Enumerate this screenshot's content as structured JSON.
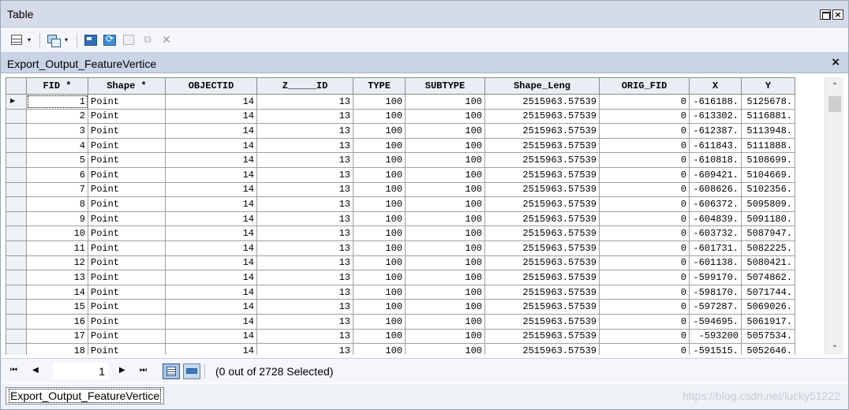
{
  "window": {
    "title": "Table"
  },
  "toolbar": {
    "icons": [
      "table-options-icon",
      "related-tables-icon",
      "select-by-attributes-icon",
      "switch-selection-icon",
      "clear-selection-icon",
      "zoom-to-selected-icon",
      "delete-selected-icon"
    ]
  },
  "tab": {
    "title": "Export_Output_FeatureVertice",
    "close": "×"
  },
  "table": {
    "columns": [
      "FID *",
      "Shape *",
      "OBJECTID",
      "Z_____ID",
      "TYPE",
      "SUBTYPE",
      "Shape_Leng",
      "ORIG_FID",
      "X",
      "Y"
    ],
    "rows": [
      [
        "1",
        "Point",
        "14",
        "13",
        "100",
        "100",
        "2515963.57539",
        "0",
        "-616188.",
        "5125678."
      ],
      [
        "2",
        "Point",
        "14",
        "13",
        "100",
        "100",
        "2515963.57539",
        "0",
        "-613302.",
        "5116881."
      ],
      [
        "3",
        "Point",
        "14",
        "13",
        "100",
        "100",
        "2515963.57539",
        "0",
        "-612387.",
        "5113948."
      ],
      [
        "4",
        "Point",
        "14",
        "13",
        "100",
        "100",
        "2515963.57539",
        "0",
        "-611843.",
        "5111888."
      ],
      [
        "5",
        "Point",
        "14",
        "13",
        "100",
        "100",
        "2515963.57539",
        "0",
        "-610818.",
        "5108699."
      ],
      [
        "6",
        "Point",
        "14",
        "13",
        "100",
        "100",
        "2515963.57539",
        "0",
        "-609421.",
        "5104669."
      ],
      [
        "7",
        "Point",
        "14",
        "13",
        "100",
        "100",
        "2515963.57539",
        "0",
        "-608626.",
        "5102356."
      ],
      [
        "8",
        "Point",
        "14",
        "13",
        "100",
        "100",
        "2515963.57539",
        "0",
        "-606372.",
        "5095809."
      ],
      [
        "9",
        "Point",
        "14",
        "13",
        "100",
        "100",
        "2515963.57539",
        "0",
        "-604839.",
        "5091180."
      ],
      [
        "10",
        "Point",
        "14",
        "13",
        "100",
        "100",
        "2515963.57539",
        "0",
        "-603732.",
        "5087947."
      ],
      [
        "11",
        "Point",
        "14",
        "13",
        "100",
        "100",
        "2515963.57539",
        "0",
        "-601731.",
        "5082225."
      ],
      [
        "12",
        "Point",
        "14",
        "13",
        "100",
        "100",
        "2515963.57539",
        "0",
        "-601138.",
        "5080421."
      ],
      [
        "13",
        "Point",
        "14",
        "13",
        "100",
        "100",
        "2515963.57539",
        "0",
        "-599170.",
        "5074862."
      ],
      [
        "14",
        "Point",
        "14",
        "13",
        "100",
        "100",
        "2515963.57539",
        "0",
        "-598170.",
        "5071744."
      ],
      [
        "15",
        "Point",
        "14",
        "13",
        "100",
        "100",
        "2515963.57539",
        "0",
        "-597287.",
        "5069026."
      ],
      [
        "16",
        "Point",
        "14",
        "13",
        "100",
        "100",
        "2515963.57539",
        "0",
        "-594695.",
        "5061917."
      ],
      [
        "17",
        "Point",
        "14",
        "13",
        "100",
        "100",
        "2515963.57539",
        "0",
        "-593200",
        "5057534."
      ],
      [
        "18",
        "Point",
        "14",
        "13",
        "100",
        "100",
        "2515963.57539",
        "0",
        "-591515.",
        "5052646."
      ]
    ]
  },
  "navigation": {
    "first": "⏮",
    "prev": "◀",
    "record": "1",
    "next": "▶",
    "last": "⏭",
    "selection_status": "(0 out of 2728 Selected)"
  },
  "bottom": {
    "tab_label": "Export_Output_FeatureVertice",
    "watermark": "https://blog.csdn.net/lucky51222"
  }
}
